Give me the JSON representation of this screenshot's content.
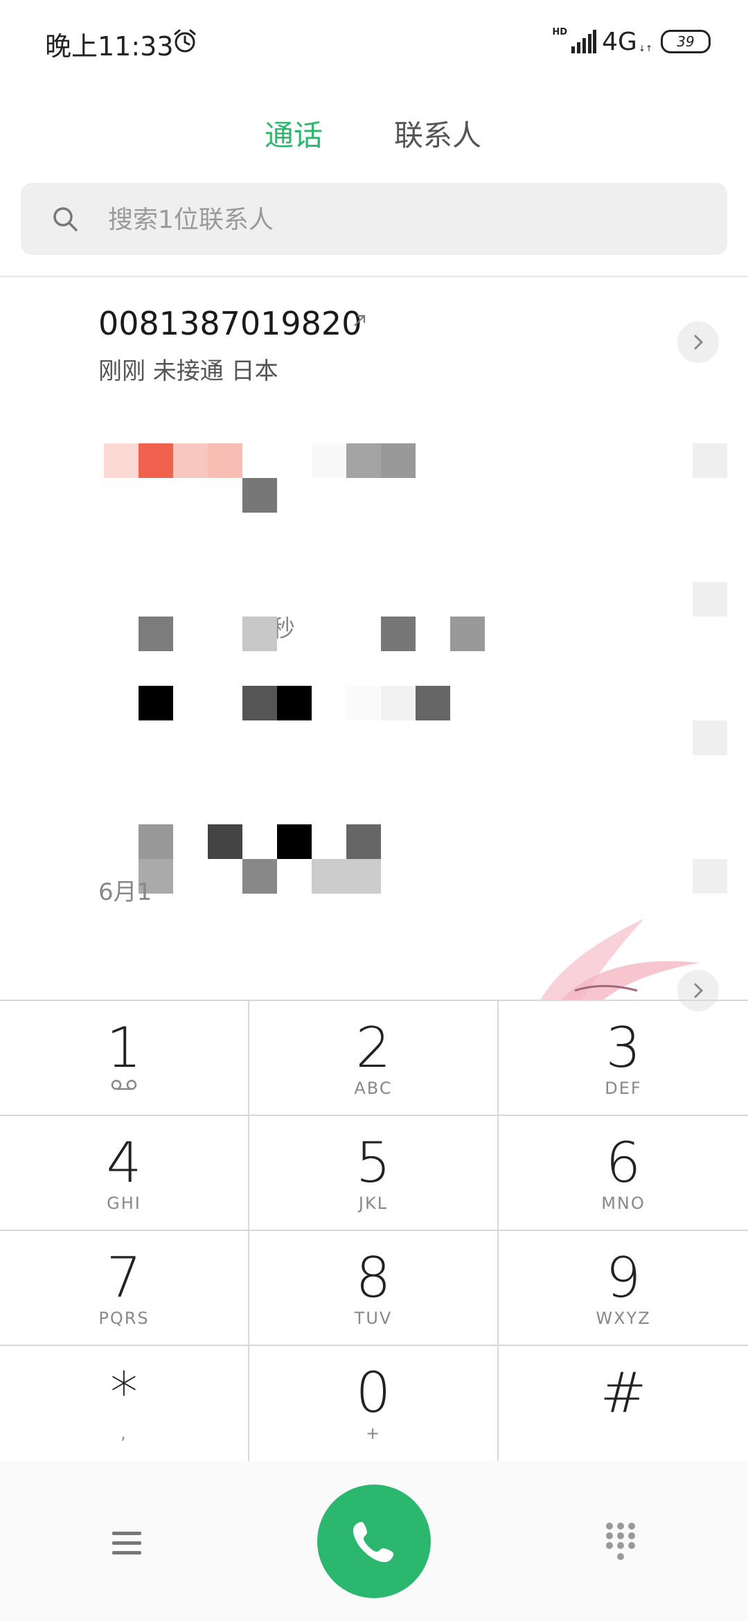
{
  "status_bar": {
    "time": "晚上11:33",
    "hd": "HD",
    "network": "4G",
    "net_arrows": "↓↑",
    "battery": "39"
  },
  "tabs": [
    {
      "label": "通话",
      "active": true
    },
    {
      "label": "联系人",
      "active": false
    }
  ],
  "search": {
    "placeholder": "搜索1位联系人"
  },
  "call_log": [
    {
      "number": "0081387019820",
      "meta": "刚刚 未接通 日本",
      "direction": "outgoing"
    }
  ],
  "blurred_fragments": {
    "seconds": "秒",
    "date": "6月1"
  },
  "dialpad": [
    {
      "digit": "1",
      "letters": "",
      "icon": "voicemail-icon"
    },
    {
      "digit": "2",
      "letters": "ABC"
    },
    {
      "digit": "3",
      "letters": "DEF"
    },
    {
      "digit": "4",
      "letters": "GHI"
    },
    {
      "digit": "5",
      "letters": "JKL"
    },
    {
      "digit": "6",
      "letters": "MNO"
    },
    {
      "digit": "7",
      "letters": "PQRS"
    },
    {
      "digit": "8",
      "letters": "TUV"
    },
    {
      "digit": "9",
      "letters": "WXYZ"
    },
    {
      "digit": "*",
      "letters": ","
    },
    {
      "digit": "0",
      "letters": "+"
    },
    {
      "digit": "#",
      "letters": ""
    }
  ],
  "colors": {
    "accent": "#2bb86e",
    "search_bg": "#efefef",
    "divider": "#d8d8d8"
  },
  "icons": [
    "alarm-icon",
    "signal-icon",
    "search-icon",
    "outgoing-call-icon",
    "chevron-right-icon",
    "voicemail-icon",
    "menu-icon",
    "phone-icon",
    "keypad-icon"
  ]
}
